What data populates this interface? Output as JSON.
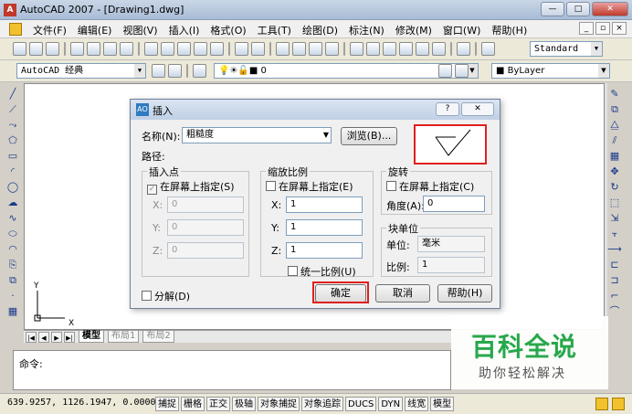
{
  "window": {
    "title": "AutoCAD 2007 - [Drawing1.dwg]",
    "app_icon": "A",
    "controls": [
      "—",
      "□",
      "✕"
    ]
  },
  "menubar": {
    "items": [
      "文件(F)",
      "编辑(E)",
      "视图(V)",
      "插入(I)",
      "格式(O)",
      "工具(T)",
      "绘图(D)",
      "标注(N)",
      "修改(M)",
      "窗口(W)",
      "帮助(H)"
    ],
    "mdi_controls": [
      "_",
      "▫",
      "×"
    ]
  },
  "toolbar1": {
    "text_style": "Standard"
  },
  "toolbar2": {
    "workspace": "AutoCAD 经典",
    "layer": "0",
    "color": "ByLayer"
  },
  "layout_tabs": [
    "模型",
    "布局1",
    "布局2"
  ],
  "ucs": {
    "x_label": "X",
    "y_label": "Y"
  },
  "command": {
    "prompt": "命令:"
  },
  "status": {
    "coords": "639.9257,  1126.1947, 0.0000",
    "buttons": [
      "捕捉",
      "栅格",
      "正交",
      "极轴",
      "对象捕捉",
      "对象追踪",
      "DUCS",
      "DYN",
      "线宽",
      "模型"
    ]
  },
  "dialog": {
    "title": "插入",
    "title_icon": "AO",
    "title_buttons": [
      "?",
      "✕"
    ],
    "name_label": "名称(N):",
    "name_value": "粗糙度",
    "browse_label": "浏览(B)...",
    "path_label": "路径:",
    "insertion": {
      "group_label": "插入点",
      "on_screen": "在屏幕上指定(S)",
      "x_label": "X:",
      "x_value": "0",
      "y_label": "Y:",
      "y_value": "0",
      "z_label": "Z:",
      "z_value": "0"
    },
    "scale": {
      "group_label": "缩放比例",
      "on_screen": "在屏幕上指定(E)",
      "x_label": "X:",
      "x_value": "1",
      "y_label": "Y:",
      "y_value": "1",
      "z_label": "Z:",
      "z_value": "1",
      "uniform": "统一比例(U)"
    },
    "rotation": {
      "group_label": "旋转",
      "on_screen": "在屏幕上指定(C)",
      "angle_label": "角度(A):",
      "angle_value": "0"
    },
    "block_unit": {
      "group_label": "块单位",
      "unit_label": "单位:",
      "unit_value": "毫米",
      "ratio_label": "比例:",
      "ratio_value": "1"
    },
    "explode": "分解(D)",
    "ok": "确定",
    "cancel": "取消",
    "help": "帮助(H)"
  },
  "watermark": {
    "title": "百科全说",
    "subtitle": "助你轻松解决"
  }
}
